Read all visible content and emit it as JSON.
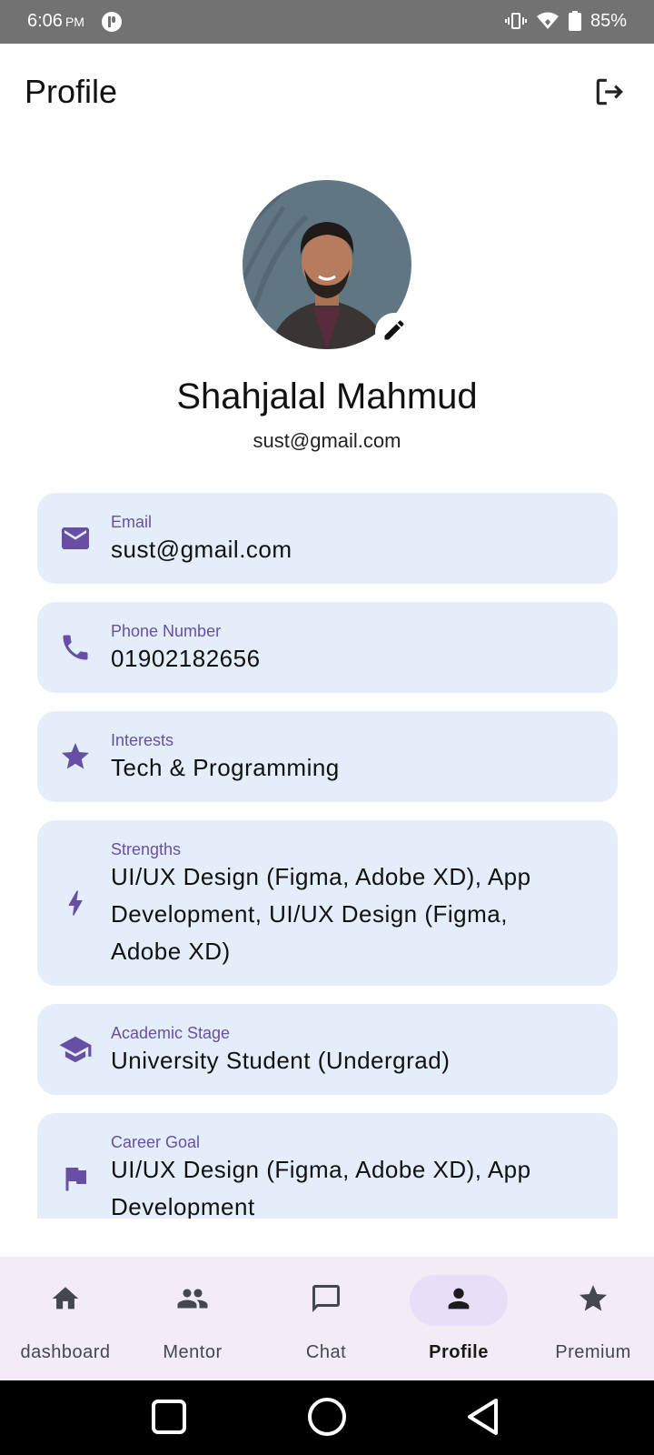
{
  "status_bar": {
    "time": "6:06",
    "ampm": "PM",
    "battery": "85%",
    "icons": [
      "vibrate-icon",
      "wifi-icon",
      "battery-icon"
    ]
  },
  "header": {
    "title": "Profile",
    "logout_icon": "logout-icon"
  },
  "profile": {
    "name": "Shahjalal Mahmud",
    "email": "sust@gmail.com",
    "edit_icon": "pencil-icon"
  },
  "cards": [
    {
      "icon": "mail-icon",
      "label": "Email",
      "value": "sust@gmail.com"
    },
    {
      "icon": "phone-icon",
      "label": "Phone Number",
      "value": "01902182656"
    },
    {
      "icon": "star-icon",
      "label": "Interests",
      "value": "Tech & Programming"
    },
    {
      "icon": "bolt-icon",
      "label": "Strengths",
      "value": "UI/UX Design (Figma, Adobe XD), App Development, UI/UX Design (Figma, Adobe XD)"
    },
    {
      "icon": "school-icon",
      "label": "Academic Stage",
      "value": "University Student (Undergrad)"
    },
    {
      "icon": "flag-icon",
      "label": "Career Goal",
      "value": "UI/UX Design (Figma, Adobe XD), App Development"
    }
  ],
  "bottom_nav": {
    "items": [
      {
        "icon": "home-icon",
        "label": "dashboard"
      },
      {
        "icon": "group-icon",
        "label": "Mentor"
      },
      {
        "icon": "chat-icon",
        "label": "Chat"
      },
      {
        "icon": "person-icon",
        "label": "Profile",
        "active": true
      },
      {
        "icon": "star-icon",
        "label": "Premium"
      }
    ]
  },
  "colors": {
    "accent": "#6750a4",
    "card_bg": "#e3eefa",
    "nav_bg": "#f3ecf7",
    "nav_active_pill": "#e8def8",
    "status_bar": "#727272"
  }
}
